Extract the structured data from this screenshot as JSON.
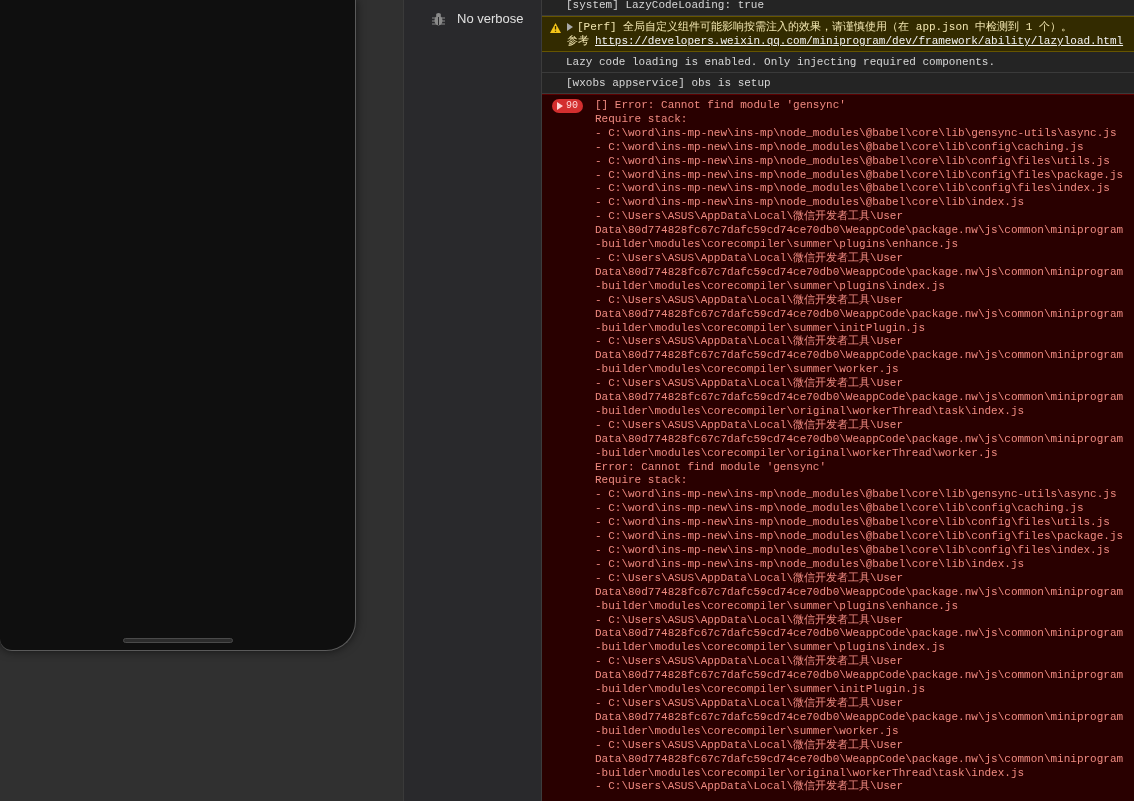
{
  "sidebar": {
    "items": [
      {
        "label": "No verbose"
      }
    ]
  },
  "console": {
    "messages": [
      {
        "kind": "log",
        "text": "[system] LazyCodeLoading: true"
      },
      {
        "kind": "warning",
        "expanded": false,
        "text": "[Perf] 全局自定义组件可能影响按需注入的效果，请谨慎使用（在 app.json 中检测到 1 个）。",
        "link_prefix": "参考",
        "link": "https://developers.weixin.qq.com/miniprogram/dev/framework/ability/lazyload.html"
      },
      {
        "kind": "log",
        "text": "Lazy code loading is enabled. Only injecting required components."
      },
      {
        "kind": "log",
        "text": "[wxobs appservice] obs is setup"
      },
      {
        "kind": "error",
        "expanded": false,
        "count": "90",
        "lines": [
          "[] Error: Cannot find module 'gensync'",
          "Require stack:",
          "- C:\\word\\ins-mp-new\\ins-mp\\node_modules\\@babel\\core\\lib\\gensync-utils\\async.js",
          "- C:\\word\\ins-mp-new\\ins-mp\\node_modules\\@babel\\core\\lib\\config\\caching.js",
          "- C:\\word\\ins-mp-new\\ins-mp\\node_modules\\@babel\\core\\lib\\config\\files\\utils.js",
          "- C:\\word\\ins-mp-new\\ins-mp\\node_modules\\@babel\\core\\lib\\config\\files\\package.js",
          "- C:\\word\\ins-mp-new\\ins-mp\\node_modules\\@babel\\core\\lib\\config\\files\\index.js",
          "- C:\\word\\ins-mp-new\\ins-mp\\node_modules\\@babel\\core\\lib\\index.js",
          "- C:\\Users\\ASUS\\AppData\\Local\\微信开发者工具\\User",
          "Data\\80d774828fc67c7dafc59cd74ce70db0\\WeappCode\\package.nw\\js\\common\\miniprogram",
          "-builder\\modules\\corecompiler\\summer\\plugins\\enhance.js",
          "- C:\\Users\\ASUS\\AppData\\Local\\微信开发者工具\\User",
          "Data\\80d774828fc67c7dafc59cd74ce70db0\\WeappCode\\package.nw\\js\\common\\miniprogram",
          "-builder\\modules\\corecompiler\\summer\\plugins\\index.js",
          "- C:\\Users\\ASUS\\AppData\\Local\\微信开发者工具\\User",
          "Data\\80d774828fc67c7dafc59cd74ce70db0\\WeappCode\\package.nw\\js\\common\\miniprogram",
          "-builder\\modules\\corecompiler\\summer\\initPlugin.js",
          "- C:\\Users\\ASUS\\AppData\\Local\\微信开发者工具\\User",
          "Data\\80d774828fc67c7dafc59cd74ce70db0\\WeappCode\\package.nw\\js\\common\\miniprogram",
          "-builder\\modules\\corecompiler\\summer\\worker.js",
          "- C:\\Users\\ASUS\\AppData\\Local\\微信开发者工具\\User",
          "Data\\80d774828fc67c7dafc59cd74ce70db0\\WeappCode\\package.nw\\js\\common\\miniprogram",
          "-builder\\modules\\corecompiler\\original\\workerThread\\task\\index.js",
          "- C:\\Users\\ASUS\\AppData\\Local\\微信开发者工具\\User",
          "Data\\80d774828fc67c7dafc59cd74ce70db0\\WeappCode\\package.nw\\js\\common\\miniprogram",
          "-builder\\modules\\corecompiler\\original\\workerThread\\worker.js",
          "Error: Cannot find module 'gensync'",
          "Require stack:",
          "- C:\\word\\ins-mp-new\\ins-mp\\node_modules\\@babel\\core\\lib\\gensync-utils\\async.js",
          "- C:\\word\\ins-mp-new\\ins-mp\\node_modules\\@babel\\core\\lib\\config\\caching.js",
          "- C:\\word\\ins-mp-new\\ins-mp\\node_modules\\@babel\\core\\lib\\config\\files\\utils.js",
          "- C:\\word\\ins-mp-new\\ins-mp\\node_modules\\@babel\\core\\lib\\config\\files\\package.js",
          "- C:\\word\\ins-mp-new\\ins-mp\\node_modules\\@babel\\core\\lib\\config\\files\\index.js",
          "- C:\\word\\ins-mp-new\\ins-mp\\node_modules\\@babel\\core\\lib\\index.js",
          "- C:\\Users\\ASUS\\AppData\\Local\\微信开发者工具\\User",
          "Data\\80d774828fc67c7dafc59cd74ce70db0\\WeappCode\\package.nw\\js\\common\\miniprogram",
          "-builder\\modules\\corecompiler\\summer\\plugins\\enhance.js",
          "- C:\\Users\\ASUS\\AppData\\Local\\微信开发者工具\\User",
          "Data\\80d774828fc67c7dafc59cd74ce70db0\\WeappCode\\package.nw\\js\\common\\miniprogram",
          "-builder\\modules\\corecompiler\\summer\\plugins\\index.js",
          "- C:\\Users\\ASUS\\AppData\\Local\\微信开发者工具\\User",
          "Data\\80d774828fc67c7dafc59cd74ce70db0\\WeappCode\\package.nw\\js\\common\\miniprogram",
          "-builder\\modules\\corecompiler\\summer\\initPlugin.js",
          "- C:\\Users\\ASUS\\AppData\\Local\\微信开发者工具\\User",
          "Data\\80d774828fc67c7dafc59cd74ce70db0\\WeappCode\\package.nw\\js\\common\\miniprogram",
          "-builder\\modules\\corecompiler\\summer\\worker.js",
          "- C:\\Users\\ASUS\\AppData\\Local\\微信开发者工具\\User",
          "Data\\80d774828fc67c7dafc59cd74ce70db0\\WeappCode\\package.nw\\js\\common\\miniprogram",
          "-builder\\modules\\corecompiler\\original\\workerThread\\task\\index.js",
          "- C:\\Users\\ASUS\\AppData\\Local\\微信开发者工具\\User"
        ]
      }
    ]
  }
}
